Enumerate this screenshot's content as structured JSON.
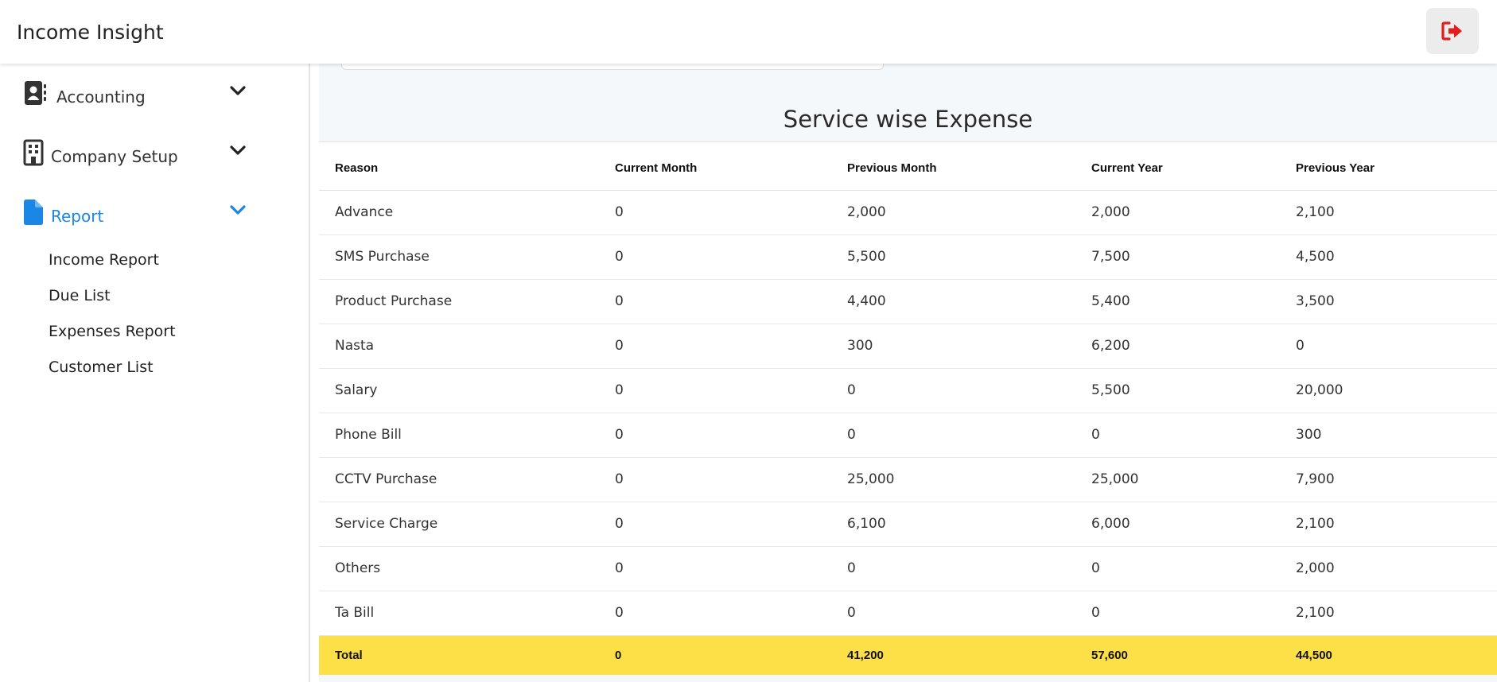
{
  "header": {
    "title": "Income Insight",
    "logout_icon": "sign-out-icon",
    "logout_color": "#e11d1d"
  },
  "sidebar": {
    "items": [
      {
        "label": "Accounting",
        "icon": "address-book-icon",
        "active": false
      },
      {
        "label": "Company Setup",
        "icon": "building-icon",
        "active": false
      },
      {
        "label": "Report",
        "icon": "file-icon",
        "active": true
      }
    ],
    "report_subitems": [
      "Income Report",
      "Due List",
      "Expenses Report",
      "Customer List"
    ],
    "active_color": "#1a86e6"
  },
  "main": {
    "section_title": "Service wise Expense",
    "table": {
      "headers": [
        "Reason",
        "Current Month",
        "Previous Month",
        "Current Year",
        "Previous Year"
      ],
      "rows": [
        [
          "Advance",
          "0",
          "2,000",
          "2,000",
          "2,100"
        ],
        [
          "SMS Purchase",
          "0",
          "5,500",
          "7,500",
          "4,500"
        ],
        [
          "Product Purchase",
          "0",
          "4,400",
          "5,400",
          "3,500"
        ],
        [
          "Nasta",
          "0",
          "300",
          "6,200",
          "0"
        ],
        [
          "Salary",
          "0",
          "0",
          "5,500",
          "20,000"
        ],
        [
          "Phone Bill",
          "0",
          "0",
          "0",
          "300"
        ],
        [
          "CCTV Purchase",
          "0",
          "25,000",
          "25,000",
          "7,900"
        ],
        [
          "Service Charge",
          "0",
          "6,100",
          "6,000",
          "2,100"
        ],
        [
          "Others",
          "0",
          "0",
          "0",
          "2,000"
        ],
        [
          "Ta Bill",
          "0",
          "0",
          "0",
          "2,100"
        ]
      ],
      "total": [
        "Total",
        "0",
        "41,200",
        "57,600",
        "44,500"
      ],
      "total_row_color": "#fde047"
    }
  }
}
